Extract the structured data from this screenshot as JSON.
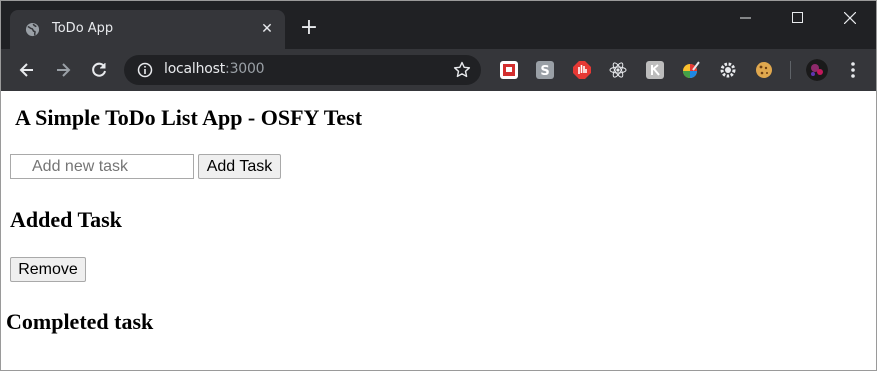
{
  "browser": {
    "tab_title": "ToDo App",
    "url_host": "localhost",
    "url_port": ":3000",
    "colors": {
      "chrome_dark": "#202124",
      "chrome_mid": "#35363a",
      "text_light": "#e8eaed"
    },
    "icons": [
      "globe-icon",
      "close-icon",
      "plus-icon",
      "minimize-icon",
      "maximize-icon",
      "window-close-icon",
      "back-icon",
      "forward-icon",
      "reload-icon",
      "info-icon",
      "star-icon",
      "menu-icon"
    ],
    "extensions": [
      "hackernews-extension-icon",
      "s-extension-icon",
      "stop-extension-icon",
      "react-devtools-icon",
      "k-extension-icon",
      "color-picker-icon",
      "gear-extension-icon",
      "cookie-extension-icon",
      "profile-avatar"
    ]
  },
  "page": {
    "title": "A Simple ToDo List App - OSFY Test",
    "new_task_placeholder": "Add new task",
    "new_task_value": "",
    "add_button_label": "Add Task",
    "added_heading": "Added Task",
    "remove_button_label": "Remove",
    "completed_heading": "Completed task"
  }
}
